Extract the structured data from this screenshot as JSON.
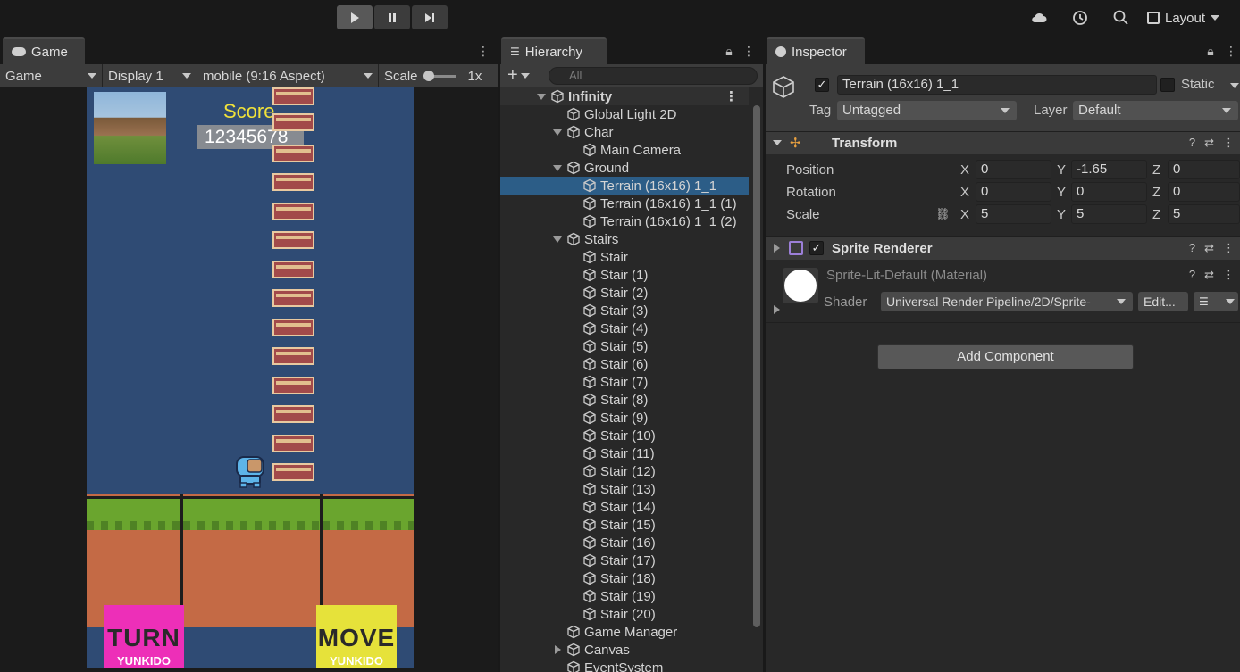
{
  "toolbar": {
    "play_icon": "play-icon",
    "pause_icon": "pause-icon",
    "step_icon": "step-icon",
    "layout_label": "Layout"
  },
  "game": {
    "tab_label": "Game",
    "mode_dropdown": "Game",
    "display_dropdown": "Display 1",
    "aspect_dropdown": "mobile (9:16 Aspect)",
    "scale_label": "Scale",
    "scale_value": "1x",
    "score_label": "Score",
    "score_value": "12345678",
    "turn_button": {
      "label": "TURN",
      "sub": "YUNKIDO",
      "color": "#ed2fb8"
    },
    "move_button": {
      "label": "MOVE",
      "sub": "YUNKIDO",
      "color": "#e6e23a"
    }
  },
  "hierarchy": {
    "tab_label": "Hierarchy",
    "search_placeholder": "All",
    "items": [
      {
        "label": "Infinity",
        "depth": 0,
        "fold": "down",
        "scene": true
      },
      {
        "label": "Global Light 2D",
        "depth": 1,
        "fold": ""
      },
      {
        "label": "Char",
        "depth": 1,
        "fold": "down"
      },
      {
        "label": "Main Camera",
        "depth": 2,
        "fold": ""
      },
      {
        "label": "Ground",
        "depth": 1,
        "fold": "down"
      },
      {
        "label": "Terrain (16x16) 1_1",
        "depth": 2,
        "fold": "",
        "selected": true
      },
      {
        "label": "Terrain (16x16) 1_1 (1)",
        "depth": 2,
        "fold": ""
      },
      {
        "label": "Terrain (16x16) 1_1 (2)",
        "depth": 2,
        "fold": ""
      },
      {
        "label": "Stairs",
        "depth": 1,
        "fold": "down"
      },
      {
        "label": "Stair",
        "depth": 2,
        "fold": ""
      },
      {
        "label": "Stair (1)",
        "depth": 2,
        "fold": ""
      },
      {
        "label": "Stair (2)",
        "depth": 2,
        "fold": ""
      },
      {
        "label": "Stair (3)",
        "depth": 2,
        "fold": ""
      },
      {
        "label": "Stair (4)",
        "depth": 2,
        "fold": ""
      },
      {
        "label": "Stair (5)",
        "depth": 2,
        "fold": ""
      },
      {
        "label": "Stair (6)",
        "depth": 2,
        "fold": ""
      },
      {
        "label": "Stair (7)",
        "depth": 2,
        "fold": ""
      },
      {
        "label": "Stair (8)",
        "depth": 2,
        "fold": ""
      },
      {
        "label": "Stair (9)",
        "depth": 2,
        "fold": ""
      },
      {
        "label": "Stair (10)",
        "depth": 2,
        "fold": ""
      },
      {
        "label": "Stair (11)",
        "depth": 2,
        "fold": ""
      },
      {
        "label": "Stair (12)",
        "depth": 2,
        "fold": ""
      },
      {
        "label": "Stair (13)",
        "depth": 2,
        "fold": ""
      },
      {
        "label": "Stair (14)",
        "depth": 2,
        "fold": ""
      },
      {
        "label": "Stair (15)",
        "depth": 2,
        "fold": ""
      },
      {
        "label": "Stair (16)",
        "depth": 2,
        "fold": ""
      },
      {
        "label": "Stair (17)",
        "depth": 2,
        "fold": ""
      },
      {
        "label": "Stair (18)",
        "depth": 2,
        "fold": ""
      },
      {
        "label": "Stair (19)",
        "depth": 2,
        "fold": ""
      },
      {
        "label": "Stair (20)",
        "depth": 2,
        "fold": ""
      },
      {
        "label": "Game Manager",
        "depth": 1,
        "fold": ""
      },
      {
        "label": "Canvas",
        "depth": 1,
        "fold": "right"
      },
      {
        "label": "EventSystem",
        "depth": 1,
        "fold": ""
      }
    ]
  },
  "inspector": {
    "tab_label": "Inspector",
    "object_name": "Terrain (16x16) 1_1",
    "static_label": "Static",
    "tag_label": "Tag",
    "tag_value": "Untagged",
    "layer_label": "Layer",
    "layer_value": "Default",
    "transform": {
      "title": "Transform",
      "position_label": "Position",
      "rotation_label": "Rotation",
      "scale_label": "Scale",
      "position": {
        "x": "0",
        "y": "-1.65",
        "z": "0"
      },
      "rotation": {
        "x": "0",
        "y": "0",
        "z": "0"
      },
      "scale": {
        "x": "5",
        "y": "5",
        "z": "5"
      },
      "x_axis": "X",
      "y_axis": "Y",
      "z_axis": "Z"
    },
    "sprite_renderer": {
      "title": "Sprite Renderer",
      "material_name": "Sprite-Lit-Default (Material)",
      "shader_label": "Shader",
      "shader_value": "Universal Render Pipeline/2D/Sprite-",
      "edit_label": "Edit..."
    },
    "add_component_label": "Add Component"
  }
}
